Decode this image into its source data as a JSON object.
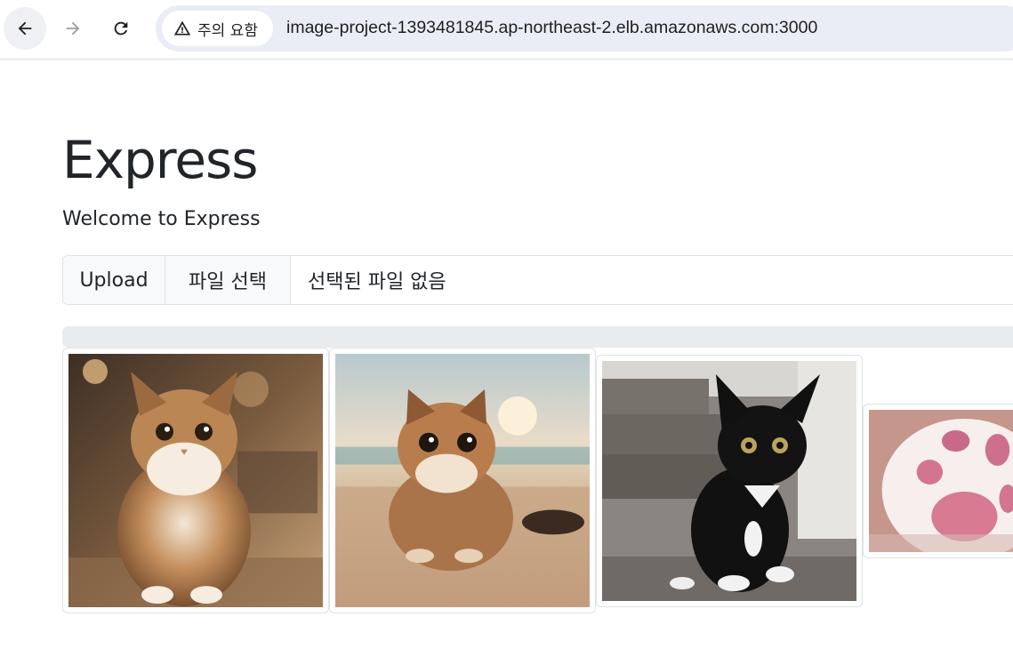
{
  "browser": {
    "security_chip": "주의 요함",
    "url": "image-project-1393481845.ap-northeast-2.elb.amazonaws.com:3000",
    "icons": [
      "back-arrow-icon",
      "forward-arrow-icon",
      "reload-icon",
      "warning-triangle-icon"
    ]
  },
  "page": {
    "title": "Express",
    "subtitle": "Welcome to Express"
  },
  "upload": {
    "button_label": "Upload",
    "choose_file_label": "파일 선택",
    "no_file_text": "선택된 파일 없음"
  },
  "progress": {
    "percent": 0,
    "track_color": "#e9ecef",
    "fill_color": "#0d6efd"
  },
  "gallery": {
    "images": [
      {
        "subject": "tabby kitten in cafe"
      },
      {
        "subject": "tabby kitten on beach"
      },
      {
        "subject": "black and white kitten on stairs"
      },
      {
        "subject": "fluffy cat paw"
      }
    ]
  }
}
